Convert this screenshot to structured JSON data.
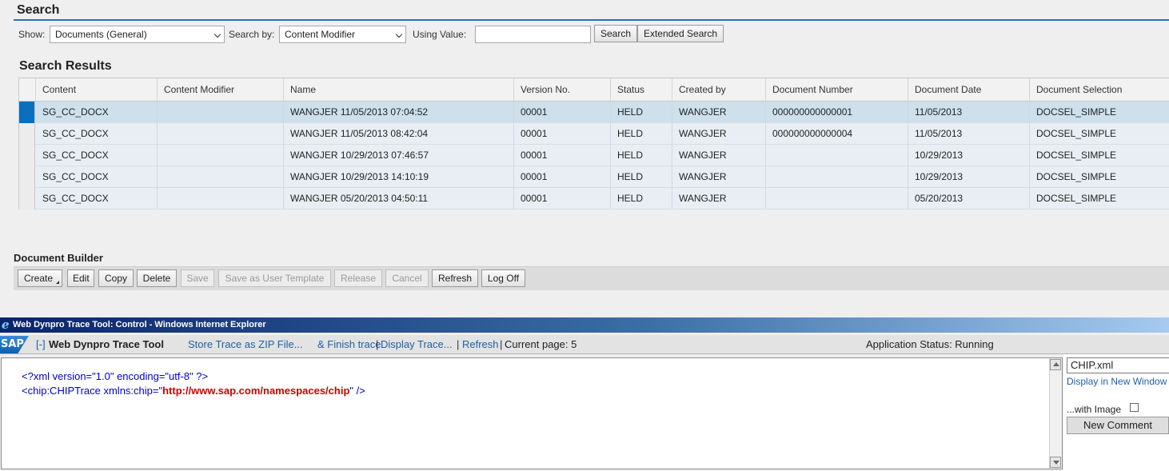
{
  "search": {
    "title": "Search",
    "show_label": "Show:",
    "show_value": "Documents (General)",
    "search_by_label": "Search by:",
    "search_by_value": "Content Modifier",
    "using_value_label": "Using Value:",
    "value_input": "",
    "search_button": "Search",
    "extended_search_button": "Extended Search"
  },
  "results": {
    "title": "Search Results",
    "columns": [
      "Content",
      "Content Modifier",
      "Name",
      "Version No.",
      "Status",
      "Created by",
      "Document Number",
      "Document Date",
      "Document Selection"
    ],
    "rows": [
      {
        "content": "SG_CC_DOCX",
        "modifier": "",
        "name": "WANGJER 11/05/2013 07:04:52",
        "version": "00001",
        "status": "HELD",
        "created_by": "WANGJER",
        "doc_number": "000000000000001",
        "doc_date": "11/05/2013",
        "selection": "DOCSEL_SIMPLE",
        "selected": true
      },
      {
        "content": "SG_CC_DOCX",
        "modifier": "",
        "name": "WANGJER 11/05/2013 08:42:04",
        "version": "00001",
        "status": "HELD",
        "created_by": "WANGJER",
        "doc_number": "000000000000004",
        "doc_date": "11/05/2013",
        "selection": "DOCSEL_SIMPLE",
        "selected": false
      },
      {
        "content": "SG_CC_DOCX",
        "modifier": "",
        "name": "WANGJER 10/29/2013 07:46:57",
        "version": "00001",
        "status": "HELD",
        "created_by": "WANGJER",
        "doc_number": "",
        "doc_date": "10/29/2013",
        "selection": "DOCSEL_SIMPLE",
        "selected": false
      },
      {
        "content": "SG_CC_DOCX",
        "modifier": "",
        "name": "WANGJER 10/29/2013 14:10:19",
        "version": "00001",
        "status": "HELD",
        "created_by": "WANGJER",
        "doc_number": "",
        "doc_date": "10/29/2013",
        "selection": "DOCSEL_SIMPLE",
        "selected": false
      },
      {
        "content": "SG_CC_DOCX",
        "modifier": "",
        "name": "WANGJER 05/20/2013 04:50:11",
        "version": "00001",
        "status": "HELD",
        "created_by": "WANGJER",
        "doc_number": "",
        "doc_date": "05/20/2013",
        "selection": "DOCSEL_SIMPLE",
        "selected": false
      }
    ]
  },
  "builder": {
    "title": "Document Builder",
    "buttons": {
      "create": "Create",
      "edit": "Edit",
      "copy": "Copy",
      "delete": "Delete",
      "save": "Save",
      "save_template": "Save as User Template",
      "release": "Release",
      "cancel": "Cancel",
      "refresh": "Refresh",
      "log_off": "Log Off"
    }
  },
  "ie": {
    "title": "Web Dynpro Trace Tool: Control - Windows Internet Explorer",
    "logo_glyph": "e"
  },
  "trace": {
    "sap_logo": "SAP",
    "collapse": "[-]",
    "tool_title": "Web Dynpro Trace Tool",
    "store_zip": "Store Trace as ZIP File...",
    "finish": "& Finish trace",
    "sep1": "|",
    "display": "Display Trace...",
    "sep2": "|",
    "refresh": "Refresh",
    "sep3": "|",
    "current_page": "Current page: 5",
    "app_status": "Application Status: Running"
  },
  "editor": {
    "line1": "<?xml version=\"1.0\" encoding=\"utf-8\" ?>",
    "line2_open": "<chip:CHIPTrace xmlns:chip=\"",
    "line2_url": "http://www.sap.com/namespaces/chip",
    "line2_close": "\" />"
  },
  "side": {
    "file": "CHIP.xml",
    "display_new": "Display in New Window",
    "with_image": "...with Image",
    "new_comment": "New Comment"
  },
  "colors": {
    "accent": "#2a72b5",
    "selected_row": "#cde0ec",
    "selected_marker": "#0a6fbf",
    "ie_title": "#0a246a"
  }
}
